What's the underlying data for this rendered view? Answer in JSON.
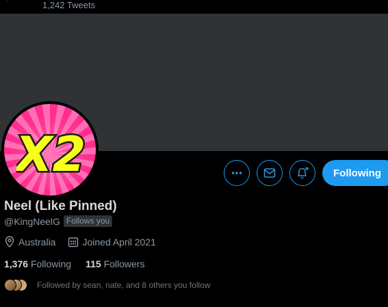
{
  "header": {
    "tweet_count": "1,242 Tweets",
    "back_icon": "arrow-left-icon"
  },
  "profile": {
    "display_name": "Neel (Like Pinned)",
    "handle": "@KingNeelG",
    "follows_you": "Follows you",
    "location": "Australia",
    "joined": "Joined April 2021",
    "avatar_text": "X2",
    "colors": {
      "banner": "#2f3336",
      "accent": "#1d9bf0",
      "avatar_pink": "#ff2e8f",
      "avatar_yellow": "#f7ff1a"
    }
  },
  "actions": {
    "more_icon": "more-icon",
    "message_icon": "mail-icon",
    "notify_icon": "bell-plus-icon",
    "following_label": "Following"
  },
  "stats": {
    "following_count": "1,376",
    "following_label": "Following",
    "followers_count": "115",
    "followers_label": "Followers"
  },
  "followed_by": {
    "text": "Followed by sean, nate, and 8 others you follow"
  }
}
